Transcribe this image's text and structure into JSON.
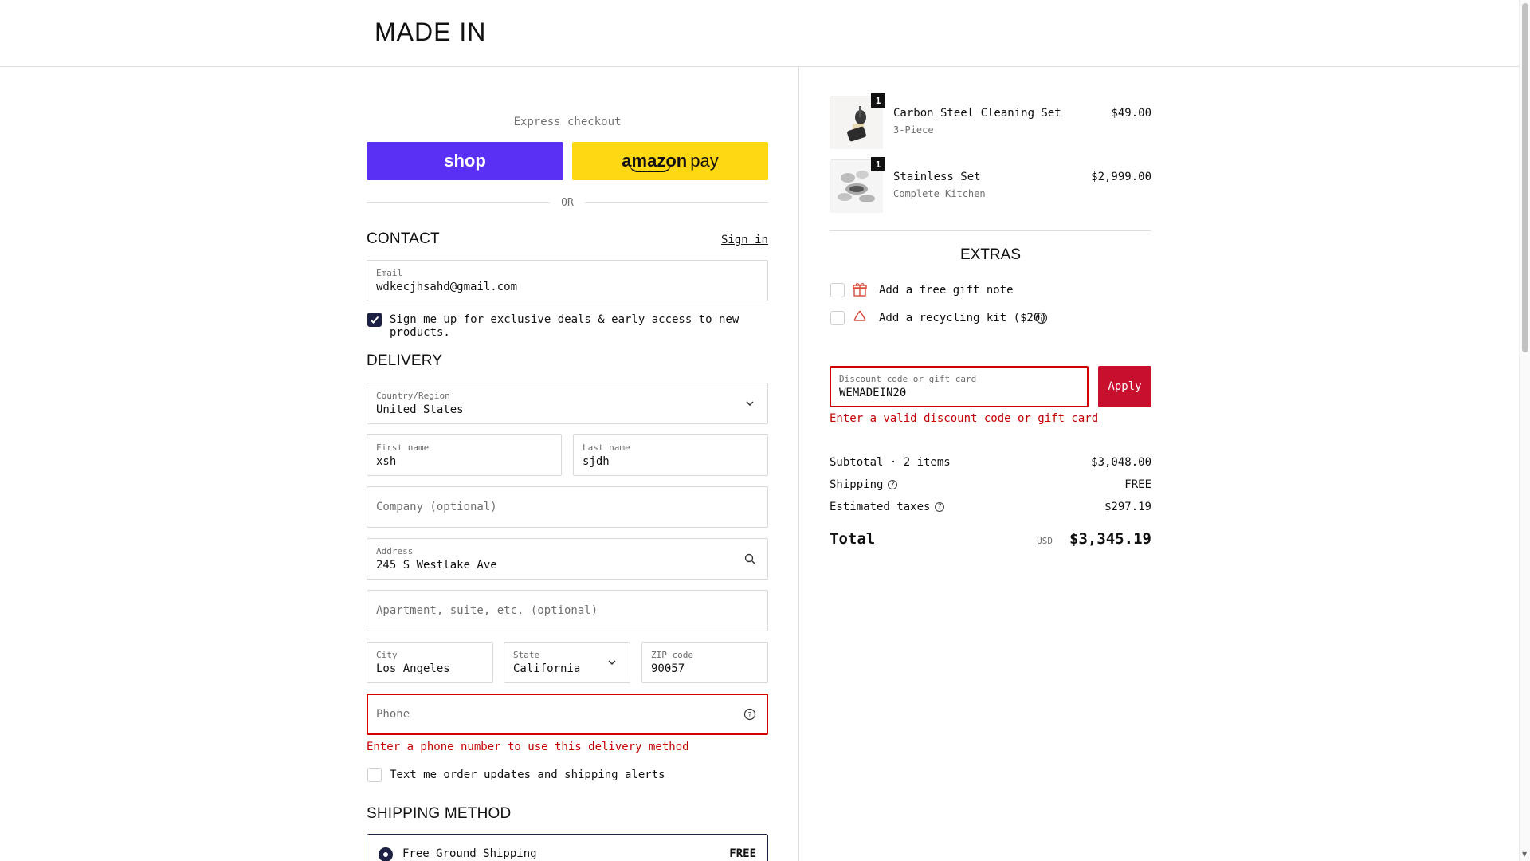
{
  "header": {
    "logo": "MADE  IN"
  },
  "express": {
    "label": "Express checkout",
    "shop_label": "shop",
    "amazon_label_bold": "amazon",
    "amazon_label": "pay",
    "or": "OR"
  },
  "contact": {
    "title": "CONTACT",
    "sign_in": "Sign in",
    "email_label": "Email",
    "email_value": "wdkecjhsahd@gmail.com",
    "newsletter_label": "Sign me up for exclusive deals & early access to new products.",
    "newsletter_checked": true
  },
  "delivery": {
    "title": "DELIVERY",
    "country_label": "Country/Region",
    "country_value": "United States",
    "first_name_label": "First name",
    "first_name_value": "xsh",
    "last_name_label": "Last name",
    "last_name_value": "sjdh",
    "company_placeholder": "Company (optional)",
    "address_label": "Address",
    "address_value": "245 S Westlake Ave",
    "apartment_placeholder": "Apartment, suite, etc. (optional)",
    "city_label": "City",
    "city_value": "Los Angeles",
    "state_label": "State",
    "state_value": "California",
    "zip_label": "ZIP code",
    "zip_value": "90057",
    "phone_placeholder": "Phone",
    "phone_error": "Enter a phone number to use this delivery method",
    "sms_label": "Text me order updates and shipping alerts",
    "sms_checked": false
  },
  "shipping": {
    "title": "SHIPPING METHOD",
    "option_label": "Free Ground Shipping",
    "option_price": "FREE"
  },
  "cart": {
    "items": [
      {
        "name": "Carbon Steel Cleaning Set",
        "variant": "3-Piece",
        "price": "$49.00",
        "qty": "1"
      },
      {
        "name": "Stainless Set",
        "variant": "Complete Kitchen",
        "price": "$2,999.00",
        "qty": "1"
      }
    ]
  },
  "extras": {
    "title": "EXTRAS",
    "gift_note": "Add a free gift note",
    "recycling_kit": "Add a recycling kit ($20)"
  },
  "discount": {
    "label": "Discount code or gift card",
    "value": "WEMADEIN20",
    "apply": "Apply",
    "error": "Enter a valid discount code or gift card"
  },
  "summary": {
    "subtotal_label": "Subtotal · 2 items",
    "subtotal_value": "$3,048.00",
    "shipping_label": "Shipping",
    "shipping_value": "FREE",
    "taxes_label": "Estimated taxes",
    "taxes_value": "$297.19",
    "total_label": "Total",
    "total_currency": "USD",
    "total_value": "$3,345.19"
  },
  "colors": {
    "shop_purple": "#5a31f4",
    "amazon_yellow": "#ffd814",
    "error_red": "#c40000",
    "apply_red": "#c8102e",
    "navy": "#1d2244"
  }
}
